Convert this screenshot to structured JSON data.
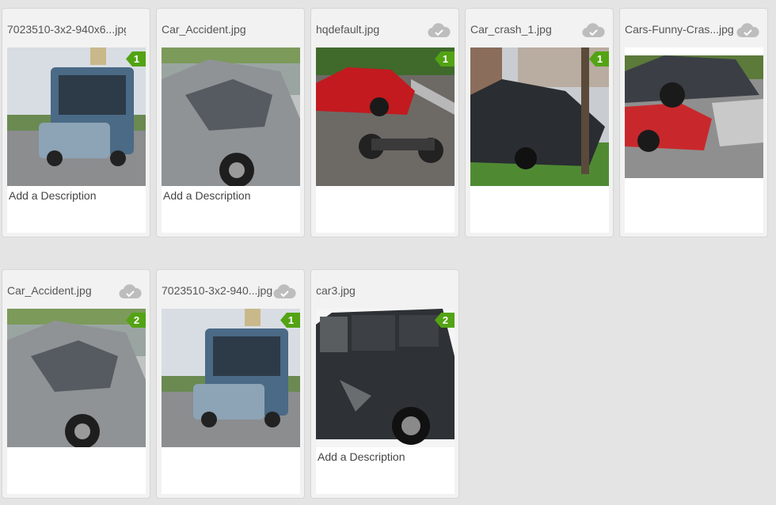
{
  "cards": [
    {
      "title": "7023510-3x2-940x6...jpg",
      "badge": "1",
      "description": "Add a Description",
      "synced": false
    },
    {
      "title": "Car_Accident.jpg",
      "badge": "",
      "description": "Add a Description",
      "synced": false
    },
    {
      "title": "hqdefault.jpg",
      "badge": "1",
      "description": "",
      "synced": true
    },
    {
      "title": "Car_crash_1.jpg",
      "badge": "1",
      "description": "",
      "synced": true
    },
    {
      "title": "Cars-Funny-Cras...jpg",
      "badge": "",
      "description": "",
      "synced": true
    },
    {
      "title": "Car_Accident.jpg",
      "badge": "2",
      "description": "",
      "synced": true
    },
    {
      "title": "7023510-3x2-940...jpg",
      "badge": "1",
      "description": "",
      "synced": true
    },
    {
      "title": "car3.jpg",
      "badge": "2",
      "description": "Add a Description",
      "synced": false
    }
  ],
  "colors": {
    "badge": "#53a314",
    "cloud": "#bdbdbd",
    "card": "#f2f2f2",
    "background": "#e4e4e4"
  },
  "icons": {
    "cloud": "cloud-check-icon"
  }
}
